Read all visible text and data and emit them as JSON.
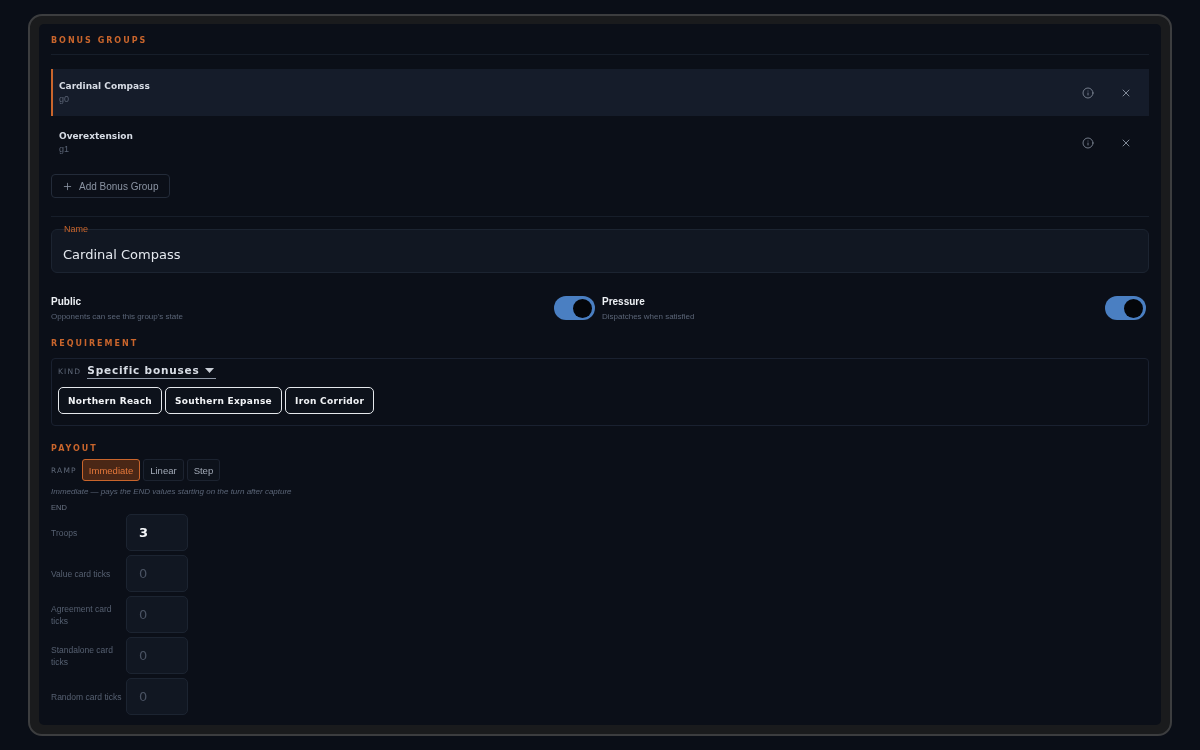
{
  "bonus_groups": {
    "heading": "BONUS GROUPS",
    "items": [
      {
        "name": "Cardinal Compass",
        "subtitle": "g0",
        "selected": true
      },
      {
        "name": "Overextension",
        "subtitle": "g1",
        "selected": false
      }
    ],
    "add_button": "Add Bonus Group"
  },
  "name_field": {
    "label": "Name",
    "value": "Cardinal Compass"
  },
  "toggles": [
    {
      "label": "Public",
      "description": "Opponents can see this group's state",
      "on": true
    },
    {
      "label": "Pressure",
      "description": "Dispatches when satisfied",
      "on": true
    }
  ],
  "requirement": {
    "heading": "REQUIREMENT",
    "kind_label": "KIND",
    "kind_value": "Specific bonuses",
    "chips": [
      "Northern Reach",
      "Southern Expanse",
      "Iron Corridor"
    ]
  },
  "payout": {
    "heading": "PAYOUT",
    "ramp_label": "RAMP",
    "ramp_options": [
      {
        "label": "Immediate",
        "selected": true
      },
      {
        "label": "Linear",
        "selected": false
      },
      {
        "label": "Step",
        "selected": false
      }
    ],
    "hint": "Immediate — pays the END values starting on the turn after capture",
    "end_label": "END",
    "fields": [
      {
        "label": "Troops",
        "value": "3"
      },
      {
        "label": "Value card ticks",
        "placeholder": "0"
      },
      {
        "label": "Agreement card ticks",
        "placeholder": "0"
      },
      {
        "label": "Standalone card ticks",
        "placeholder": "0"
      },
      {
        "label": "Random card ticks",
        "placeholder": "0"
      }
    ]
  }
}
